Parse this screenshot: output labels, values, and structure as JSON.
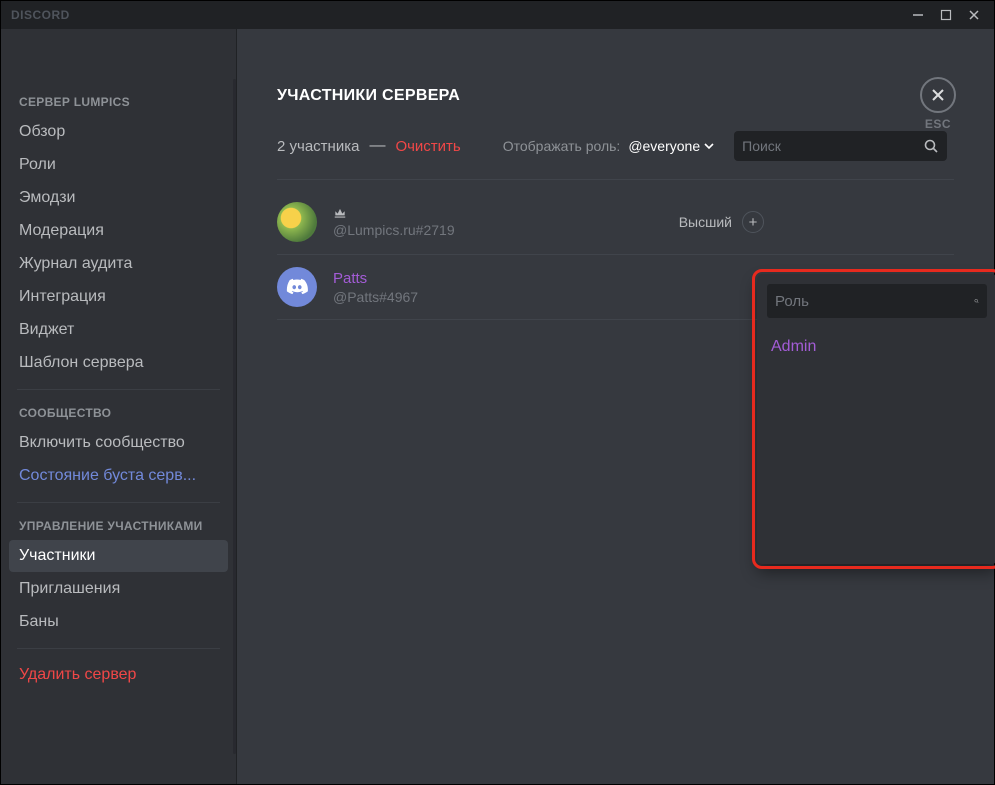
{
  "app": {
    "brand": "DISCORD",
    "esc_label": "ESC"
  },
  "sidebar": {
    "header1": "СЕРВЕР LUMPICS",
    "items1": [
      "Обзор",
      "Роли",
      "Эмодзи",
      "Модерация",
      "Журнал аудита",
      "Интеграция",
      "Виджет",
      "Шаблон сервера"
    ],
    "header2": "Сообщество",
    "items2_plain": "Включить сообщество",
    "items2_brand": "Состояние буста серв...",
    "header3": "Управление участниками",
    "items3": [
      "Участники",
      "Приглашения",
      "Баны"
    ],
    "delete": "Удалить сервер"
  },
  "page": {
    "title": "Участники сервера",
    "count_text": "2 участника",
    "clear": "Очистить",
    "role_filter_label": "Отображать роль:",
    "role_filter_value": "@everyone",
    "search_placeholder": "Поиск"
  },
  "members": [
    {
      "display_name": "",
      "tag": "@Lumpics.ru#2719",
      "owner": true,
      "role_label": "Высший"
    },
    {
      "display_name": "Patts",
      "tag": "@Patts#4967",
      "owner": false,
      "colored": true
    }
  ],
  "popover": {
    "search_placeholder": "Роль",
    "options": [
      "Admin"
    ]
  }
}
